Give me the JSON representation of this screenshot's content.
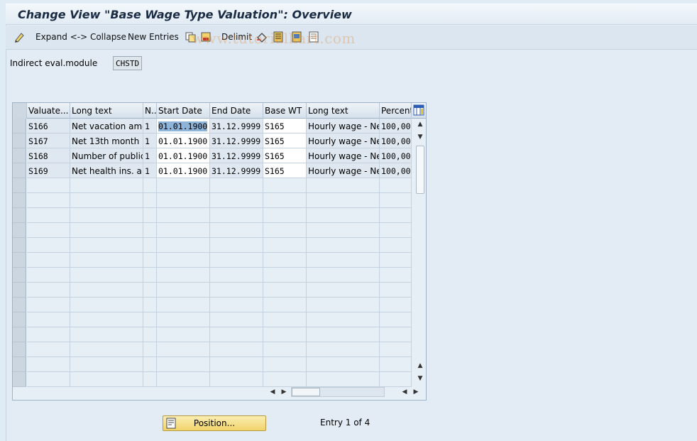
{
  "window": {
    "title": "Change View \"Base Wage Type Valuation\": Overview"
  },
  "toolbar": {
    "expand_collapse": "Expand <-> Collapse",
    "new_entries": "New Entries",
    "delimit": "Delimit",
    "watermark": "www.tutorialkart.com"
  },
  "field": {
    "label": "Indirect eval.module",
    "value": "CHSTD"
  },
  "table": {
    "headers": [
      "Valuate...",
      "Long text",
      "N..",
      "Start Date",
      "End Date",
      "Base WT",
      "Long text",
      "Percent"
    ],
    "rows": [
      [
        "S166",
        "Net vacation amo...",
        "1",
        "01.01.1900",
        "31.12.9999",
        "S165",
        "Hourly wage - Net",
        "100,00"
      ],
      [
        "S167",
        "Net 13th month ...",
        "1",
        "01.01.1900",
        "31.12.9999",
        "S165",
        "Hourly wage - Net",
        "100,00"
      ],
      [
        "S168",
        "Number of public...",
        "1",
        "01.01.1900",
        "31.12.9999",
        "S165",
        "Hourly wage - Net",
        "100,00"
      ],
      [
        "S169",
        "Net health ins. a...",
        "1",
        "01.01.1900",
        "31.12.9999",
        "S165",
        "Hourly wage - Net",
        "100,00"
      ]
    ]
  },
  "footer": {
    "position_button": "Position...",
    "entry_text": "Entry 1 of 4"
  }
}
